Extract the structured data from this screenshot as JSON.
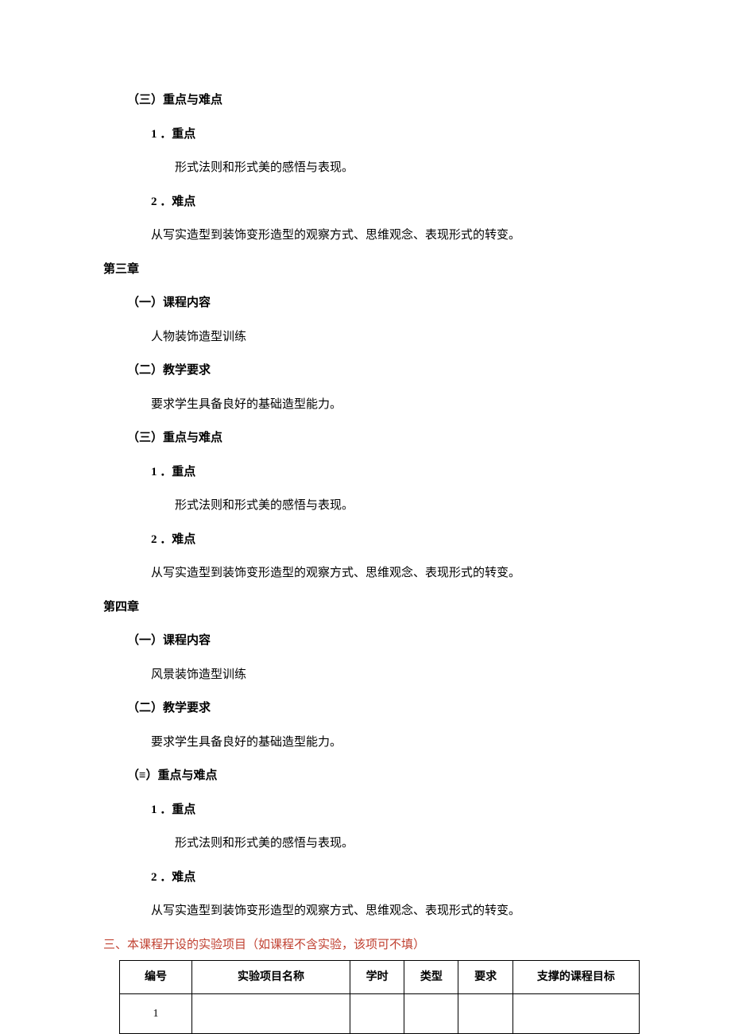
{
  "sec1": {
    "h3": "（三）重点与难点",
    "t1": "1 ．重点",
    "b1": "形式法则和形式美的感悟与表现。",
    "t2": "2 ．难点",
    "b2": "从写实造型到装饰变形造型的观察方式、思维观念、表现形式的转变。"
  },
  "ch3": {
    "title": "第三章",
    "s1": "（一）课程内容",
    "b1": "人物装饰造型训练",
    "s2": "（二）教学要求",
    "b2": "要求学生具备良好的基础造型能力。",
    "s3": "（三）重点与难点",
    "t1": "1 ．重点",
    "c1": "形式法则和形式美的感悟与表现。",
    "t2": "2 ．难点",
    "c2": "从写实造型到装饰变形造型的观察方式、思维观念、表现形式的转变。"
  },
  "ch4": {
    "title": "第四章",
    "s1": "（一）课程内容",
    "b1": "风景装饰造型训练",
    "s2": "（二）教学要求",
    "b2": "要求学生具备良好的基础造型能力。",
    "s3": "（≡）重点与难点",
    "t1": "1 ．重点",
    "c1": "形式法则和形式美的感悟与表现。",
    "t2": "2 ．难点",
    "c2": "从写实造型到装饰变形造型的观察方式、思维观念、表现形式的转变。"
  },
  "exp": {
    "heading": "三、本课程开设的实验项目（如课程不含实验，该项可不填）",
    "headers": [
      "编号",
      "实验项目名称",
      "学时",
      "类型",
      "要求",
      "支撑的课程目标"
    ],
    "row1idx": "1"
  }
}
